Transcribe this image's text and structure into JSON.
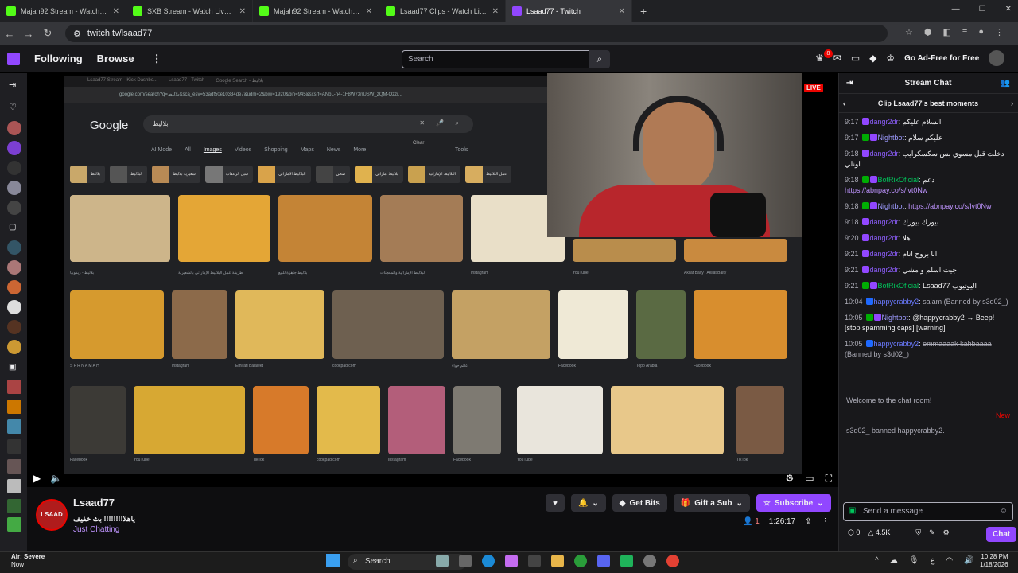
{
  "browser": {
    "tabs": [
      {
        "title": "Majah92 Stream - Watch Live o",
        "color": "#53fc18",
        "active": false
      },
      {
        "title": "SXB Stream - Watch Live on Ki",
        "color": "#53fc18",
        "active": false
      },
      {
        "title": "Majah92 Stream - Watch Live o",
        "color": "#53fc18",
        "active": false
      },
      {
        "title": "Lsaad77 Clips - Watch Live on I",
        "color": "#53fc18",
        "active": false
      },
      {
        "title": "Lsaad77 - Twitch",
        "color": "#9147ff",
        "active": true
      }
    ],
    "url": "twitch.tv/lsaad77"
  },
  "twitch_nav": {
    "following": "Following",
    "browse": "Browse",
    "search_placeholder": "Search",
    "ad_free": "Go Ad-Free for Free",
    "notif_count": "8"
  },
  "stream_screen": {
    "google_logo": "Google",
    "query": "بلاليط",
    "url": "google.com/search?q=بلاليط&sca_esv=53adf50e10334de7&udm=2&biw=1920&bih=945&sxsrf=ANbL-n4-1F8W73nUSW_zQM-Ozzr...",
    "clear_label": "Clear",
    "filters": [
      "AI Mode",
      "All",
      "Images",
      "Videos",
      "Shopping",
      "Maps",
      "News",
      "More"
    ],
    "active_filter": "Images",
    "tools": "Tools",
    "chips": [
      "بلاليط",
      "البلاليط",
      "شعيرية بلاليط",
      "سيل الزعفاب",
      "البلاليط الاماراتي",
      "صحي",
      "بلاليط اماراتي",
      "البلاليط الإماراتية",
      "عمل البلاليط"
    ],
    "row1_captions": [
      "بلاليط - ريكوبيا",
      "طريقة عمل البلاليط الإماراتي بالشعيرية",
      "بلاليط جاهزة للبيع",
      "البلاليط الإماراتية والمعجنات",
      "Instagram",
      "YouTube",
      "Akilat Baity | Akilat Baity"
    ],
    "row2_captions": [
      "S F R N A M A H",
      "Instagram",
      "Emirati Balaleet",
      "cookpad.com",
      "عالم حواء",
      "Facebook",
      "Topo Arabia",
      "Facebook"
    ],
    "row3_captions": [
      "Facebook",
      "YouTube",
      "TikTok",
      "cookpad.com",
      "Instagram",
      "Facebook",
      "YouTube",
      "TikTok"
    ],
    "live_label": "LIVE"
  },
  "stream_info": {
    "channel": "Lsaad77",
    "title": "ياهلا!!!!!!!! بث خفيف",
    "category": "Just Chatting",
    "avatar_text": "LSAAD",
    "viewers": "1",
    "uptime": "1:26:17",
    "get_bits": "Get Bits",
    "gift_sub": "Gift a Sub",
    "subscribe": "Subscribe"
  },
  "chat": {
    "header": "Stream Chat",
    "clip_banner": "Clip Lsaad77's best moments",
    "messages": [
      {
        "time": "9:17",
        "user": "dangr2dr",
        "color": "#8a5cf6",
        "badges": [
          "#9147ff"
        ],
        "text": "السلام عليكم"
      },
      {
        "time": "9:17",
        "user": "Nightbot",
        "color": "#9e9bff",
        "badges": [
          "#00ad03",
          "#9147ff"
        ],
        "text": "عليكم سلام"
      },
      {
        "time": "9:18",
        "user": "dangr2dr",
        "color": "#8a5cf6",
        "badges": [
          "#9147ff"
        ],
        "text": "دخلت قبل مسوي بس سكسكرايب اونلي"
      },
      {
        "time": "9:18",
        "user": "BotRixOficial",
        "color": "#00c75c",
        "badges": [
          "#00ad03",
          "#9147ff"
        ],
        "text": "دعم",
        "link": "https://abnpay.co/s/lvt0Nw"
      },
      {
        "time": "9:18",
        "user": "Nightbot",
        "color": "#9e9bff",
        "badges": [
          "#00ad03",
          "#9147ff"
        ],
        "text": "",
        "link": "https://abnpay.co/s/lvt0Nw"
      },
      {
        "time": "9:18",
        "user": "dangr2dr",
        "color": "#8a5cf6",
        "badges": [
          "#9147ff"
        ],
        "text": "بيورك بيورك"
      },
      {
        "time": "9:20",
        "user": "dangr2dr",
        "color": "#8a5cf6",
        "badges": [
          "#9147ff"
        ],
        "text": "هلا"
      },
      {
        "time": "9:21",
        "user": "dangr2dr",
        "color": "#8a5cf6",
        "badges": [
          "#9147ff"
        ],
        "text": "انا بروح انام"
      },
      {
        "time": "9:21",
        "user": "dangr2dr",
        "color": "#8a5cf6",
        "badges": [
          "#9147ff"
        ],
        "text": "جيت اسلم و مشي"
      },
      {
        "time": "9:21",
        "user": "BotRixOficial",
        "color": "#00c75c",
        "badges": [
          "#00ad03",
          "#9147ff"
        ],
        "text": "Lsaad77 اليوتيوب"
      },
      {
        "time": "10:04",
        "user": "happycrabby2",
        "color": "#6b7bff",
        "badges": [
          "#1e69ff"
        ],
        "deleted": "salam",
        "note": "(Banned by s3d02_)"
      },
      {
        "time": "10:05",
        "user": "Nightbot",
        "color": "#9e9bff",
        "badges": [
          "#00ad03",
          "#9147ff"
        ],
        "text": "@happycrabby2 → Beep! [stop spamming caps] [warning]"
      },
      {
        "time": "10:05",
        "user": "happycrabby2",
        "color": "#6b7bff",
        "badges": [
          "#1e69ff"
        ],
        "deleted": "ommaaaak kahbaaaa",
        "note": "(Banned by s3d02_)"
      }
    ],
    "welcome": "Welcome to the chat room!",
    "new_label": "New",
    "ban_notice": "s3d02_ banned happycrabby2.",
    "input_placeholder": "Send a message",
    "points": "0",
    "bits": "4.5K",
    "chat_button": "Chat"
  },
  "taskbar": {
    "weather_title": "Air: Severe",
    "weather_sub": "Now",
    "search": "Search",
    "time": "10:28 PM",
    "date": "1/18/2026"
  }
}
